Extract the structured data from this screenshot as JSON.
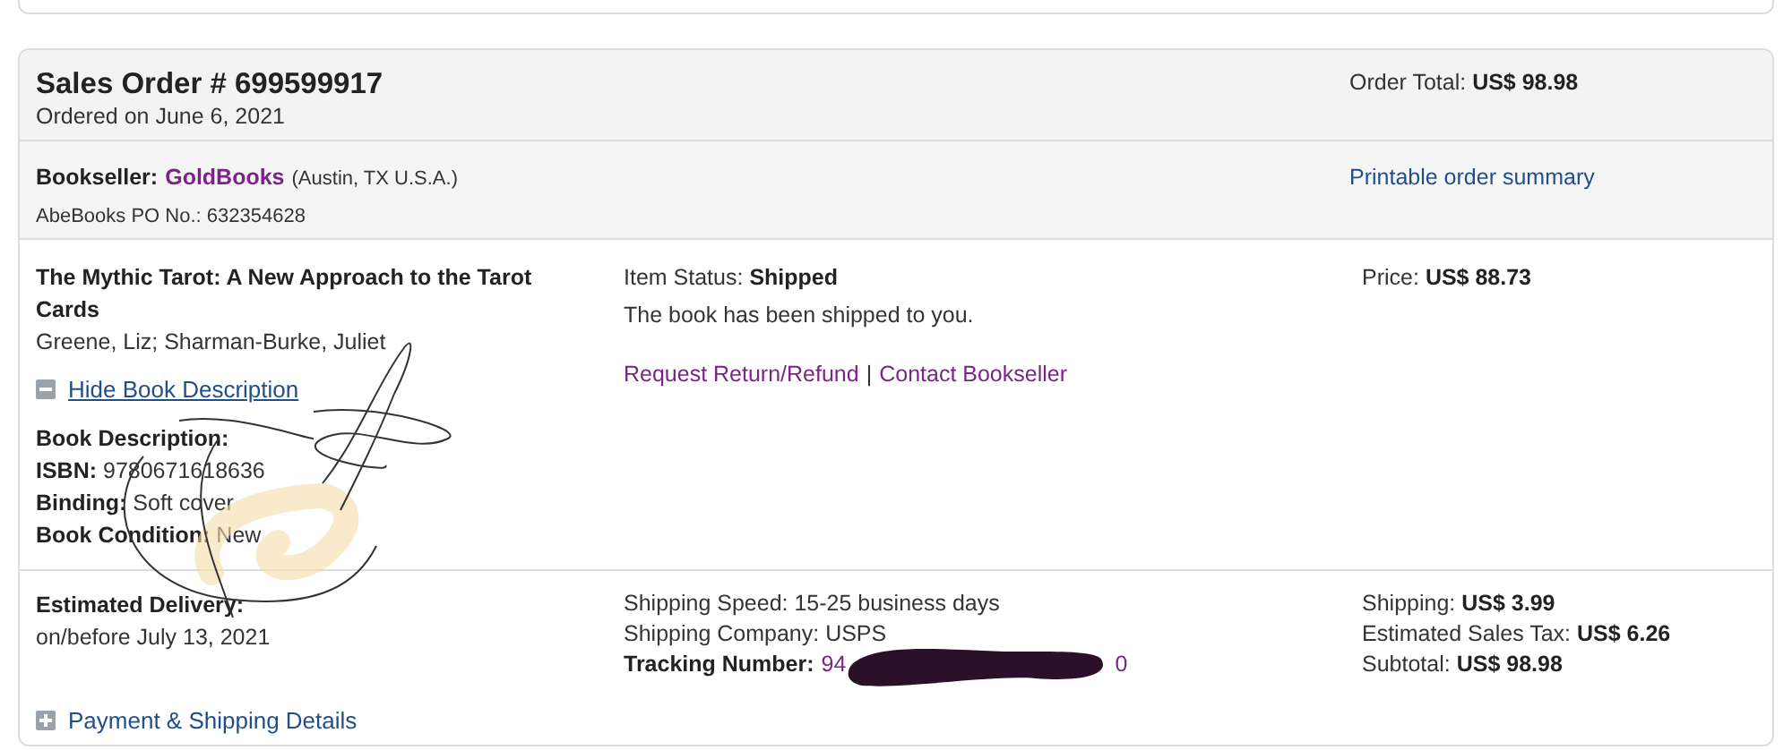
{
  "order": {
    "title": "Sales Order # 699599917",
    "ordered_on": "Ordered on June 6, 2021",
    "total_label": "Order Total:",
    "total_value": "US$ 98.98"
  },
  "seller": {
    "label": "Bookseller:",
    "name": "GoldBooks",
    "location": "(Austin, TX U.S.A.)",
    "po": "AbeBooks PO No.: 632354628",
    "summary_link": "Printable order summary"
  },
  "item": {
    "title": "The Mythic Tarot: A New Approach to the Tarot Cards",
    "authors": "Greene, Liz; Sharman-Burke, Juliet",
    "toggle": {
      "label": "Hide Book Description",
      "expanded": true
    },
    "description": [
      {
        "label": "Book Description:"
      },
      {
        "label": "ISBN:",
        "value": "9780671618636"
      },
      {
        "label": "Binding:",
        "value": "Soft cover"
      },
      {
        "label": "Book Condition:",
        "value": "New"
      }
    ],
    "status_label": "Item Status:",
    "status_value": "Shipped",
    "status_note": "The book has been shipped to you.",
    "links": [
      "Request Return/Refund",
      "Contact Bookseller"
    ],
    "separator": "|",
    "price_label": "Price:",
    "price_value": "US$ 88.73"
  },
  "delivery": {
    "label": "Estimated Delivery:",
    "date": "on/before July 13, 2021",
    "shipping_lines": [
      "Shipping Speed: 15-25 business days",
      "Shipping Company: USPS"
    ],
    "tracking_label": "Tracking Number:",
    "tracking_start": "94",
    "tracking_end": "0",
    "totals": [
      {
        "label": "Shipping:",
        "value": "US$ 3.99"
      },
      {
        "label": "Estimated Sales Tax:",
        "value": "US$ 6.26"
      },
      {
        "label": "Subtotal:",
        "value": "US$ 98.98"
      }
    ],
    "details_toggle": {
      "label": "Payment & Shipping Details",
      "expanded": false
    }
  }
}
